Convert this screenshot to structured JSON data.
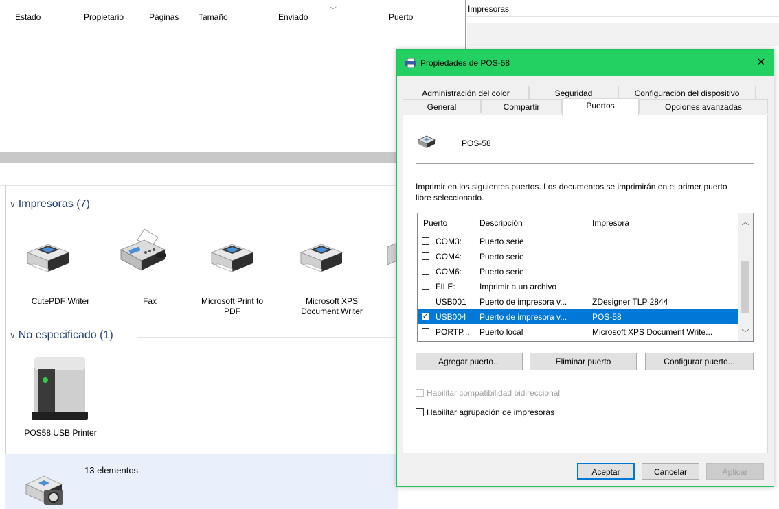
{
  "queue": {
    "columns": [
      "Estado",
      "Propietario",
      "Páginas",
      "Tamaño",
      "Enviado",
      "Puerto"
    ],
    "sort_icon": "chevron-down-icon"
  },
  "right_panel": {
    "title": "Impresoras"
  },
  "explorer": {
    "groups": [
      {
        "label": "Impresoras (7)",
        "items": [
          "CutePDF Writer",
          "Fax",
          "Microsoft Print to PDF",
          "Microsoft XPS Document Writer"
        ]
      },
      {
        "label": "No especificado (1)",
        "items": [
          "POS58 USB Printer"
        ]
      }
    ],
    "status_text": "13 elementos"
  },
  "dialog": {
    "title": "Propiedades de POS-58",
    "close_label": "✕",
    "tabs_row1": [
      "Administración del color",
      "Seguridad",
      "Configuración del dispositivo"
    ],
    "tabs_row2": [
      "General",
      "Compartir",
      "Puertos",
      "Opciones avanzadas"
    ],
    "active_tab": "Puertos",
    "printer_name": "POS-58",
    "description": "Imprimir en los siguientes puertos. Los documentos se imprimirán en el primer puerto libre seleccionado.",
    "list_headers": [
      "Puerto",
      "Descripción",
      "Impresora"
    ],
    "ports": [
      {
        "port": "COM3:",
        "desc": "Puerto serie",
        "printer": "",
        "checked": false,
        "selected": false
      },
      {
        "port": "COM4:",
        "desc": "Puerto serie",
        "printer": "",
        "checked": false,
        "selected": false
      },
      {
        "port": "COM6:",
        "desc": "Puerto serie",
        "printer": "",
        "checked": false,
        "selected": false
      },
      {
        "port": "FILE:",
        "desc": "Imprimir a un archivo",
        "printer": "",
        "checked": false,
        "selected": false
      },
      {
        "port": "USB001",
        "desc": "Puerto de impresora v...",
        "printer": "ZDesigner TLP 2844",
        "checked": false,
        "selected": false
      },
      {
        "port": "USB004",
        "desc": "Puerto de impresora v...",
        "printer": "POS-58",
        "checked": true,
        "selected": true
      },
      {
        "port": "PORTP...",
        "desc": "Puerto local",
        "printer": "Microsoft XPS Document Write...",
        "checked": false,
        "selected": false
      }
    ],
    "buttons": {
      "add": "Agregar puerto...",
      "delete": "Eliminar puerto",
      "configure": "Configurar puerto..."
    },
    "bidirectional_label": "Habilitar compatibilidad bidireccional",
    "pooling_label": "Habilitar agrupación de impresoras",
    "footer": {
      "ok": "Aceptar",
      "cancel": "Cancelar",
      "apply": "Aplicar"
    }
  },
  "colors": {
    "accent_green": "#22d161",
    "selection_blue": "#0078d7",
    "group_text": "#1f3f7a"
  }
}
